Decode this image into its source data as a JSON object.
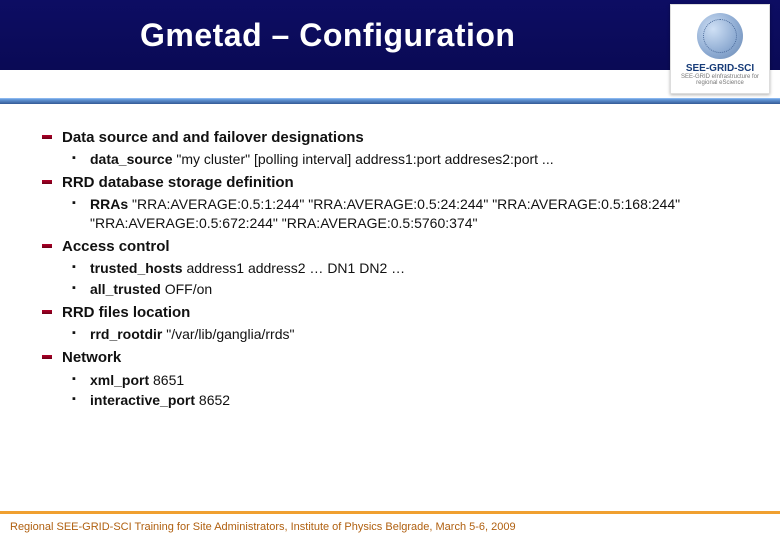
{
  "title": "Gmetad – Configuration",
  "logo": {
    "name": "SEE-GRID-SCI",
    "sub": "SEE-GRID eInfrastructure for regional eScience"
  },
  "items": [
    {
      "head": "Data source and and failover designations",
      "subs": [
        {
          "bold": "data_source",
          "rest": " \"my cluster\" [polling interval] address1:port addreses2:port ..."
        }
      ]
    },
    {
      "head": "RRD database storage definition",
      "subs": [
        {
          "bold": "RRAs",
          "rest": " \"RRA:AVERAGE:0.5:1:244\" \"RRA:AVERAGE:0.5:24:244\" \"RRA:AVERAGE:0.5:168:244\" \"RRA:AVERAGE:0.5:672:244\" \"RRA:AVERAGE:0.5:5760:374\""
        }
      ]
    },
    {
      "head": "Access control",
      "subs": [
        {
          "bold": "trusted_hosts",
          "rest": " address1 address2 … DN1 DN2 …"
        },
        {
          "bold": "all_trusted",
          "rest": " OFF/on"
        }
      ]
    },
    {
      "head": "RRD files location",
      "subs": [
        {
          "bold": "rrd_rootdir",
          "rest": " \"/var/lib/ganglia/rrds\""
        }
      ]
    },
    {
      "head": "Network",
      "subs": [
        {
          "bold": "xml_port",
          "rest": " 8651"
        },
        {
          "bold": "interactive_port",
          "rest": " 8652"
        }
      ]
    }
  ],
  "footer": "Regional SEE-GRID-SCI Training for Site Administrators, Institute of Physics Belgrade, March 5-6, 2009"
}
